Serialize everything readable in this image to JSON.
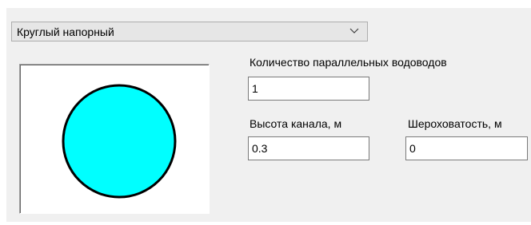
{
  "section_type": {
    "selected": "Круглый напорный"
  },
  "preview": {
    "shape": "circle",
    "fill_color": "#00ffff",
    "stroke_color": "#000000"
  },
  "fields": {
    "parallel_count": {
      "label": "Количество параллельных водоводов",
      "value": "1"
    },
    "channel_height": {
      "label": "Высота канала, м",
      "value": "0.3"
    },
    "roughness": {
      "label": "Шероховатость, м",
      "value": "0"
    }
  },
  "icons": {
    "dropdown_arrow": "chevron-down-icon"
  }
}
